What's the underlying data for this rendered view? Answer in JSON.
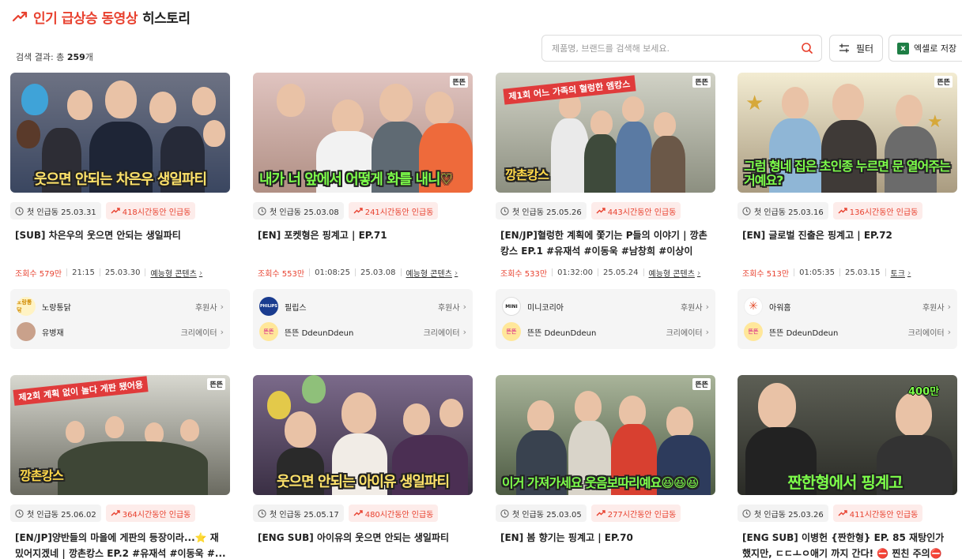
{
  "header": {
    "title_accent": "인기 급상승 동영상",
    "title_plain": "히스토리"
  },
  "results": {
    "label": "검색 결과: 총",
    "count": "259",
    "unit": "개"
  },
  "search": {
    "placeholder": "제품명, 브랜드를 검색해 보세요.",
    "value": ""
  },
  "toolbar": {
    "filter_label": "필터",
    "excel_label": "엑셀로 저장",
    "excel_icon_letter": "x"
  },
  "cards": [
    {
      "caption": "웃으면 안되는 차은우 생일파티",
      "first_trend": "첫 인급동 25.03.31",
      "trend_hours": "418시간동안 인급동",
      "title": "[SUB] 차은우의 웃으면 안되는 생일파티",
      "views": "조회수 579만",
      "duration": "21:15",
      "upload_date": "25.03.30",
      "category": "예능형 콘텐츠",
      "sponsor": {
        "name": "노랑통닭",
        "role": "후원사",
        "logo_text": "노랑통닭",
        "logo_bg": "#fff3c4",
        "logo_fg": "#d08a00"
      },
      "creator": {
        "name": "유병재",
        "role": "크리에이터",
        "logo_text": "",
        "logo_bg": "#c9a18b",
        "logo_fg": "#fff"
      },
      "colors": {
        "bg": "#5a5f6e",
        "bg2": "#2c3a55"
      }
    },
    {
      "caption": "내가 너 앞에서 어떻게 화를 내니♡",
      "first_trend": "첫 인급동 25.03.08",
      "trend_hours": "241시간동안 인급동",
      "title": "[EN] 포켓형은 핑계고 | EP.71",
      "views": "조회수 553만",
      "duration": "01:08:25",
      "upload_date": "25.03.08",
      "category": "예능형 콘텐츠",
      "sponsor": {
        "name": "필립스",
        "role": "후원사",
        "logo_text": "PHILIPS",
        "logo_bg": "#1a3c8f",
        "logo_fg": "#fff"
      },
      "creator": {
        "name": "뜬뜬 DdeunDdeun",
        "role": "크리에이터",
        "logo_text": "뜬뜬",
        "logo_bg": "#ffe79a",
        "logo_fg": "#e0508c"
      },
      "colors": {
        "bg": "#d9b8b4",
        "bg2": "#8a6a5c"
      }
    },
    {
      "caption": "깡촌캉스",
      "first_trend": "첫 인급동 25.05.26",
      "trend_hours": "443시간동안 인급동",
      "title": "[EN/JP]혈렁한 계획에 쫓기는 P들의 이야기 | 깡촌캉스 EP.1 #유재석 #이동욱 #남창희 #이상이",
      "views": "조회수 533만",
      "duration": "01:32:00",
      "upload_date": "25.05.24",
      "category": "예능형 콘텐츠",
      "sponsor": {
        "name": "미니코리아",
        "role": "후원사",
        "logo_text": "MINI",
        "logo_bg": "#ffffff",
        "logo_fg": "#222"
      },
      "creator": {
        "name": "뜬뜬 DdeunDdeun",
        "role": "크리에이터",
        "logo_text": "뜬뜬",
        "logo_bg": "#ffe79a",
        "logo_fg": "#e0508c"
      },
      "colors": {
        "bg": "#b8b9ad",
        "bg2": "#6b6e62"
      }
    },
    {
      "caption": "그럼 형네 집은 초인종 누르면 문 열어주는 거예요?",
      "first_trend": "첫 인급동 25.03.16",
      "trend_hours": "136시간동안 인급동",
      "title": "[EN] 글로벌 진출은 핑계고 | EP.72",
      "views": "조회수 513만",
      "duration": "01:05:35",
      "upload_date": "25.03.15",
      "category": "토크",
      "sponsor": {
        "name": "아워홈",
        "role": "후원사",
        "logo_text": "✳",
        "logo_bg": "#ffffff",
        "logo_fg": "#e34b2a"
      },
      "creator": {
        "name": "뜬뜬 DdeunDdeun",
        "role": "크리에이터",
        "logo_text": "뜬뜬",
        "logo_bg": "#ffe79a",
        "logo_fg": "#e0508c"
      },
      "colors": {
        "bg": "#efe6c8",
        "bg2": "#6c6354"
      }
    },
    {
      "caption": "깡촌캉스",
      "first_trend": "첫 인급동 25.06.02",
      "trend_hours": "364시간동안 인급동",
      "title": "[EN/JP]양반들의 마을에 게판의 등장이라...⭐ 재밌어지겠네 | 깡촌캉스 EP.2 #유재석 #이동욱 #..."
    },
    {
      "caption": "웃으면 안되는 아이유 생일파티",
      "first_trend": "첫 인급동 25.05.17",
      "trend_hours": "480시간동안 인급동",
      "title": "[ENG SUB] 아이유의 웃으면 안되는 생일파티"
    },
    {
      "caption": "이거 가져가세요 웃음보따리예요😆😆😆",
      "first_trend": "첫 인급동 25.03.05",
      "trend_hours": "277시간동안 인급동",
      "title": "[EN] 봄 향기는 핑계고 | EP.70"
    },
    {
      "caption": "짠한형에서 핑계고",
      "first_trend": "첫 인급동 25.03.26",
      "trend_hours": "411시간동안 인급동",
      "title": "[ENG SUB] 이병헌 {짠한형} EP. 85 재탕인가 했지만, ㄷㄷㅗㅇ애기 까지 간다! ⛔ 찐친 주의⛔"
    }
  ],
  "thumb_marks": {
    "channel": "뜬뜬",
    "views_badge": "400만"
  },
  "colors": {
    "accent": "#e8412f",
    "badge_bg": "#fdecea",
    "panel_bg": "#f5f5f5"
  }
}
